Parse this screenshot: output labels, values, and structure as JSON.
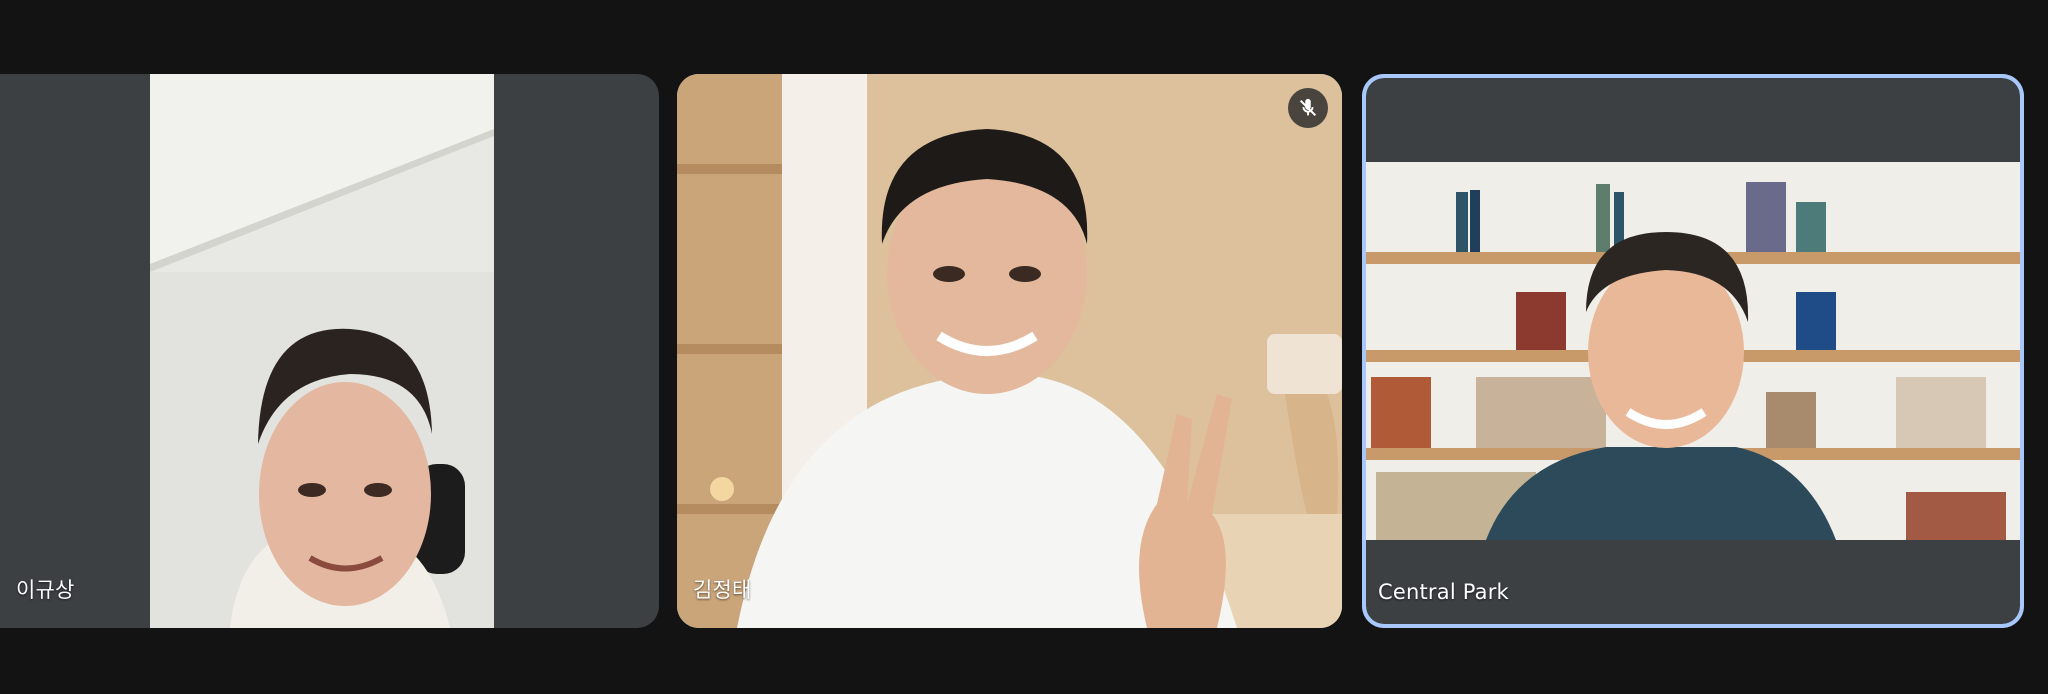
{
  "participants": [
    {
      "name": "이규상",
      "muted": false,
      "speaking": false
    },
    {
      "name": "김정태",
      "muted": true,
      "speaking": false
    },
    {
      "name": "Central Park",
      "muted": false,
      "speaking": true
    }
  ],
  "colors": {
    "background": "#131314",
    "tile": "#3c4043",
    "active_outline": "#a8c7fa"
  },
  "icons": {
    "mute": "mic-off-icon"
  }
}
